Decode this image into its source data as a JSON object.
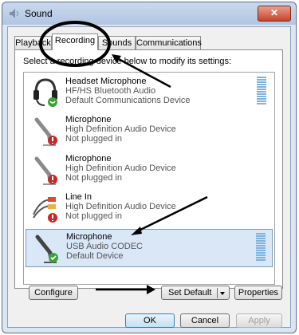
{
  "window": {
    "title": "Sound",
    "close_label": "✕"
  },
  "tabs": [
    {
      "label": "Playback"
    },
    {
      "label": "Recording"
    },
    {
      "label": "Sounds"
    },
    {
      "label": "Communications"
    }
  ],
  "instruction": "Select a recording device below to modify its settings:",
  "devices": [
    {
      "name": "Headset Microphone",
      "line1": "HF/HS Bluetooth Audio",
      "line2": "Default Communications Device",
      "status": "communications",
      "icon": "headset-icon"
    },
    {
      "name": "Microphone",
      "line1": "High Definition Audio Device",
      "line2": "Not plugged in",
      "status": "unplugged",
      "icon": "microphone-icon"
    },
    {
      "name": "Microphone",
      "line1": "High Definition Audio Device",
      "line2": "Not plugged in",
      "status": "unplugged",
      "icon": "microphone-icon"
    },
    {
      "name": "Line In",
      "line1": "High Definition Audio Device",
      "line2": "Not plugged in",
      "status": "unplugged",
      "icon": "line-in-cable-icon"
    },
    {
      "name": "Microphone",
      "line1": "USB Audio CODEC",
      "line2": "Default Device",
      "status": "default",
      "icon": "microphone-icon",
      "selected": true
    }
  ],
  "buttons": {
    "configure": "Configure",
    "set_default": "Set Default",
    "properties": "Properties",
    "ok": "OK",
    "cancel": "Cancel",
    "apply": "Apply"
  },
  "colors": {
    "status_green": "#3aa33a",
    "status_red": "#c62828",
    "selection": "#d9e7f6",
    "meter": "#7fb3df"
  }
}
